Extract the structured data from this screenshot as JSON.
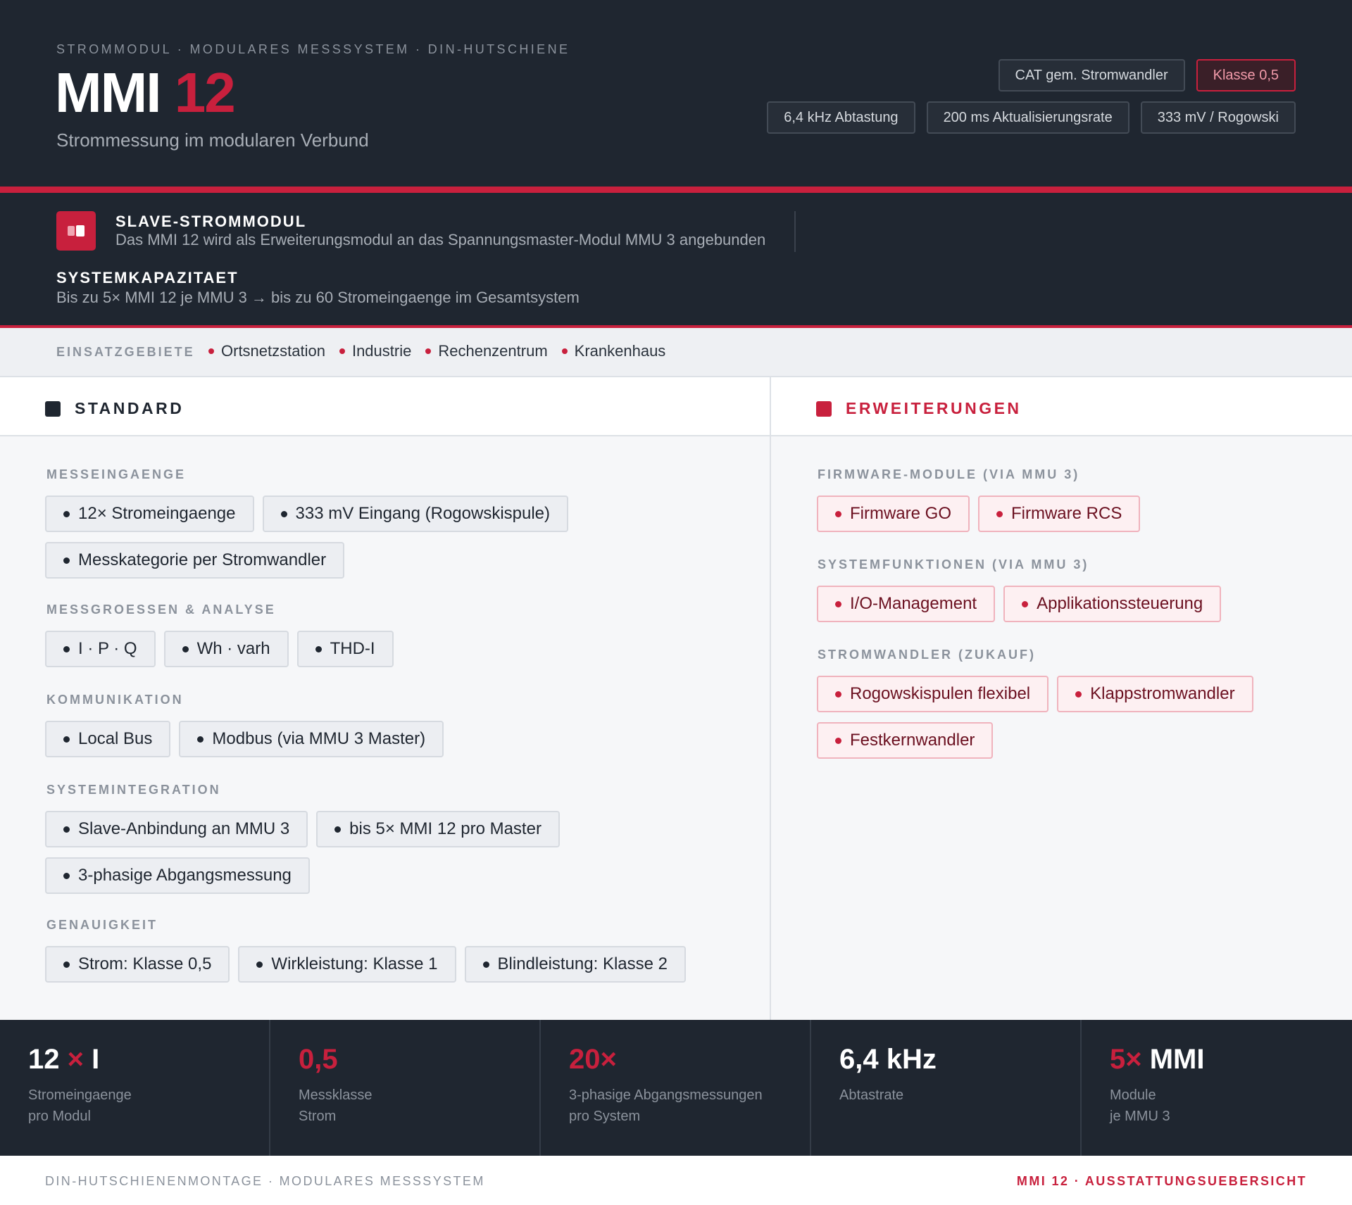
{
  "header": {
    "eyebrow": "STROMMODUL · MODULARES MESSSYSTEM · DIN-HUTSCHIENE",
    "title_main": "MMI",
    "title_accent": "12",
    "subtitle": "Strommessung im modularen Verbund",
    "tags_row1": [
      "CAT gem. Stromwandler",
      "Klasse 0,5"
    ],
    "tags_row2": [
      "6,4 kHz Abtastung",
      "200 ms Aktualisierungsrate",
      "333 mV / Rogowski"
    ]
  },
  "info": {
    "slave_title": "SLAVE-STROMMODUL",
    "slave_text": "Das MMI 12 wird als Erweiterungsmodul an das Spannungsmaster-Modul MMU 3 angebunden",
    "system_title": "SYSTEMKAPAZITAET",
    "system_text": "Bis zu 5× MMI 12 je MMU 3 → bis zu 60 Stromeingaenge im Gesamtsystem"
  },
  "einsatz": {
    "label": "EINSATZGEBIETE",
    "items": [
      "Ortsnetzstation",
      "Industrie",
      "Rechenzentrum",
      "Krankenhaus"
    ]
  },
  "standard": {
    "heading": "STANDARD",
    "sections": [
      {
        "label": "MESSEINGAENGE",
        "items": [
          "12× Stromeingaenge",
          "333 mV Eingang (Rogowskispule)",
          "Messkategorie per Stromwandler"
        ]
      },
      {
        "label": "MESSGROESSEN & ANALYSE",
        "items": [
          "I · P · Q",
          "Wh · varh",
          "THD-I"
        ]
      },
      {
        "label": "KOMMUNIKATION",
        "items": [
          "Local Bus",
          "Modbus (via MMU 3 Master)"
        ]
      },
      {
        "label": "SYSTEMINTEGRATION",
        "items": [
          "Slave-Anbindung an MMU 3",
          "bis 5× MMI 12 pro Master",
          "3-phasige Abgangsmessung"
        ]
      },
      {
        "label": "GENAUIGKEIT",
        "items": [
          "Strom: Klasse 0,5",
          "Wirkleistung: Klasse 1",
          "Blindleistung: Klasse 2"
        ]
      }
    ]
  },
  "erweiterungen": {
    "heading": "ERWEITERUNGEN",
    "sections": [
      {
        "label": "FIRMWARE-MODULE (VIA MMU 3)",
        "items": [
          "Firmware GO",
          "Firmware RCS"
        ]
      },
      {
        "label": "SYSTEMFUNKTIONEN (VIA MMU 3)",
        "items": [
          "I/O-Management",
          "Applikationssteuerung"
        ]
      },
      {
        "label": "STROMWANDLER (ZUKAUF)",
        "items": [
          "Rogowskispulen flexibel",
          "Klappstromwandler",
          "Festkernwandler"
        ]
      }
    ]
  },
  "stats": [
    {
      "v1": "12",
      "v1_red": false,
      "v2": "×",
      "v2_red": true,
      "v3": " I",
      "v3_red": false,
      "l1": "Stromeingaenge",
      "l2": "pro Modul"
    },
    {
      "v1": "0,5",
      "v1_red": true,
      "v2": "",
      "v2_red": false,
      "v3": "",
      "v3_red": false,
      "l1": "Messklasse",
      "l2": "Strom"
    },
    {
      "v1": "20×",
      "v1_red": true,
      "v2": "",
      "v2_red": false,
      "v3": "",
      "v3_red": false,
      "l1": "3-phasige Abgangsmessungen",
      "l2": "pro System"
    },
    {
      "v1": "6,4 kHz",
      "v1_red": false,
      "v2": "",
      "v2_red": false,
      "v3": "",
      "v3_red": false,
      "l1": "Abtastrate",
      "l2": ""
    },
    {
      "v1": "5×",
      "v1_red": true,
      "v2": " MMI",
      "v2_red": false,
      "v3": "",
      "v3_red": false,
      "l1": "Module",
      "l2": "je MMU 3"
    }
  ],
  "footer": {
    "left": "DIN-HUTSCHIENENMONTAGE · MODULARES MESSSYSTEM",
    "right": "MMI 12 · AUSSTATTUNGSUEBERSICHT"
  },
  "colors": {
    "brand_red": "#c8203d",
    "dark": "#1f2630"
  }
}
